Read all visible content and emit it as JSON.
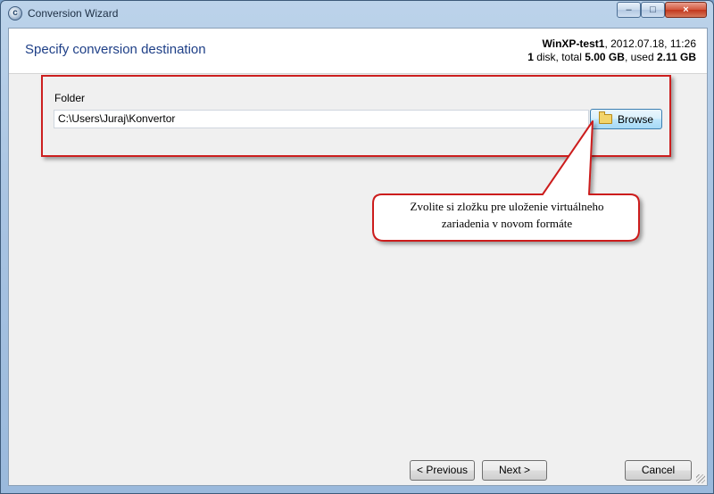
{
  "window": {
    "title": "Conversion Wizard",
    "controls": {
      "minimize": "–",
      "maximize": "□",
      "close": "×"
    }
  },
  "header": {
    "title": "Specify conversion destination",
    "vm_name": "WinXP-test1",
    "vm_date": ", 2012.07.18,  11:26",
    "disk_count": "1",
    "disk_text": " disk, total ",
    "disk_total": "5.00 GB",
    "used_text": ", used ",
    "disk_used": "2.11 GB"
  },
  "folder": {
    "label": "Folder",
    "value": "C:\\Users\\Juraj\\Konvertor",
    "browse_label": "Browse"
  },
  "callout": {
    "line1": "Zvolite si zložku pre uloženie virtuálneho",
    "line2": "zariadenia v novom formáte"
  },
  "footer": {
    "previous_label": "< Previous",
    "next_label": "Next >",
    "cancel_label": "Cancel"
  },
  "colors": {
    "title_blue": "#1e3f87",
    "highlight_red": "#cc1f1f",
    "client_bg": "#f0f0f0"
  },
  "icons": {
    "app": "conversion-app-icon",
    "browse": "folder-icon"
  }
}
